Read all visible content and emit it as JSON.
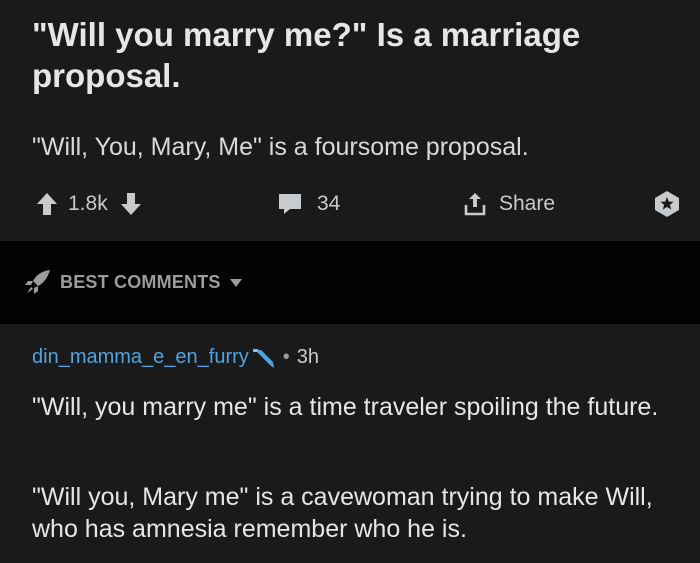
{
  "post": {
    "title": "\"Will you marry me?\" Is a marriage proposal.",
    "body": "\"Will, You, Mary, Me\" is a foursome proposal.",
    "votes": "1.8k",
    "comments": "34",
    "share_label": "Share"
  },
  "sort_bar": {
    "label": "BEST COMMENTS"
  },
  "comment": {
    "author": "din_mamma_e_en_furry",
    "age": "3h",
    "separator": "•",
    "paragraphs": [
      "\"Will, you marry me\" is a time traveler spoiling the future.",
      "\"Will you, Mary me\" is a cavewoman trying to make Will, who has amnesia remember who he is."
    ]
  },
  "icons": {
    "upvote": "upvote-arrow-icon",
    "downvote": "downvote-arrow-icon",
    "comment": "comment-bubble-icon",
    "share": "share-upload-icon",
    "award": "award-badge-icon",
    "sort": "rocket-icon",
    "caret": "caret-down-icon",
    "flair": "flair-pencil-icon"
  },
  "colors": {
    "background": "#1a1a1b",
    "sort_bar_background": "#030303",
    "text": "#d7dadc",
    "muted": "#9a9c9e",
    "author_link": "#4fa3e0",
    "flair": "#4fa3e0"
  }
}
